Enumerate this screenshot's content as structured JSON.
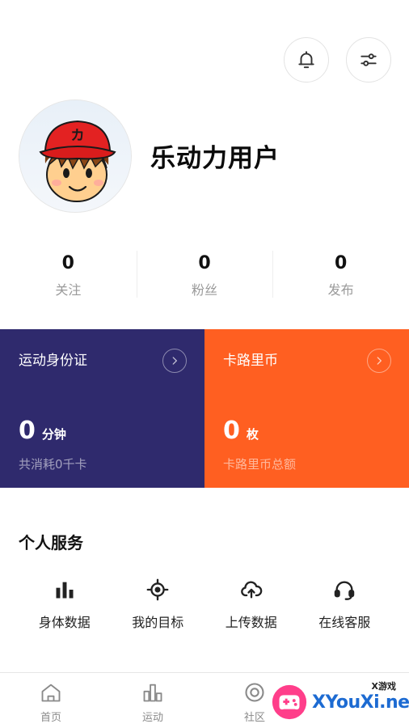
{
  "header": {
    "bell_icon": "bell-icon",
    "settings_icon": "sliders-icon"
  },
  "profile": {
    "username": "乐动力用户",
    "avatar_icon": "cartoon-avatar"
  },
  "stats": [
    {
      "value": "0",
      "label": "关注"
    },
    {
      "value": "0",
      "label": "粉丝"
    },
    {
      "value": "0",
      "label": "发布"
    }
  ],
  "cards": {
    "sport_id": {
      "title": "运动身份证",
      "value": "0",
      "unit": "分钟",
      "sub": "共消耗0千卡",
      "color": "#2f2a6d"
    },
    "kaluli": {
      "title": "卡路里币",
      "value": "0",
      "unit": "枚",
      "sub": "卡路里币总额",
      "color": "#ff5f21"
    }
  },
  "services": {
    "title": "个人服务",
    "items": [
      {
        "label": "身体数据",
        "icon": "bar-chart-icon"
      },
      {
        "label": "我的目标",
        "icon": "target-icon"
      },
      {
        "label": "上传数据",
        "icon": "cloud-upload-icon"
      },
      {
        "label": "在线客服",
        "icon": "headset-icon"
      }
    ]
  },
  "tabbar": {
    "items": [
      {
        "label": "首页",
        "icon": "home-icon"
      },
      {
        "label": "运动",
        "icon": "sport-icon"
      },
      {
        "label": "社区",
        "icon": "community-icon"
      }
    ]
  },
  "watermark": {
    "small": "X游戏",
    "text": "XYouXi.net"
  }
}
